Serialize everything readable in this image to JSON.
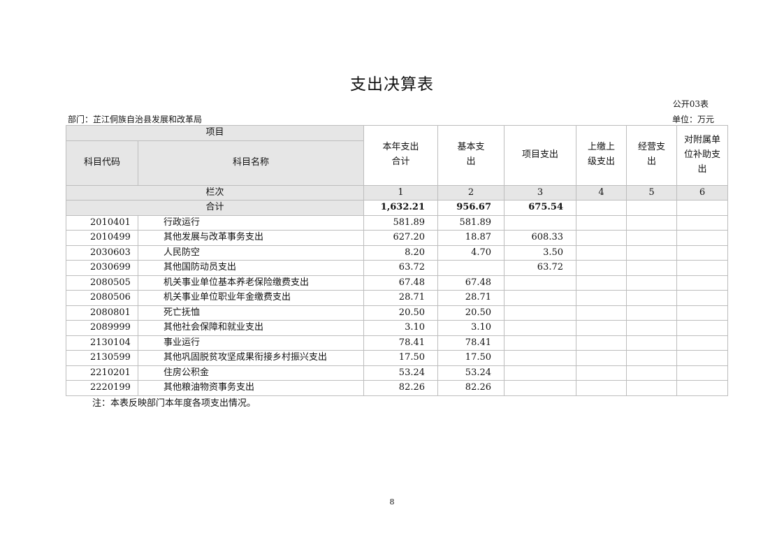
{
  "title": "支出决算表",
  "table_no": "公开03表",
  "department": "部门：芷江侗族自治县发展和改革局",
  "unit": "单位：万元",
  "header": {
    "item": "项目",
    "code": "科目代码",
    "name": "科目名称",
    "total": "本年支出合计",
    "basic": "基本支出",
    "project": "项目支出",
    "upper": "上缴上级支出",
    "business": "经营支出",
    "subsidy": "对附属单位补助支出",
    "col_label": "栏次",
    "col_nums": [
      "1",
      "2",
      "3",
      "4",
      "5",
      "6"
    ]
  },
  "sum_row": {
    "label": "合计",
    "total": "1,632.21",
    "basic": "956.67",
    "project": "675.54"
  },
  "rows": [
    {
      "code": "2010401",
      "name": "行政运行",
      "total": "581.89",
      "basic": "581.89",
      "project": ""
    },
    {
      "code": "2010499",
      "name": "其他发展与改革事务支出",
      "total": "627.20",
      "basic": "18.87",
      "project": "608.33"
    },
    {
      "code": "2030603",
      "name": "人民防空",
      "total": "8.20",
      "basic": "4.70",
      "project": "3.50"
    },
    {
      "code": "2030699",
      "name": "其他国防动员支出",
      "total": "63.72",
      "basic": "",
      "project": "63.72"
    },
    {
      "code": "2080505",
      "name": "机关事业单位基本养老保险缴费支出",
      "total": "67.48",
      "basic": "67.48",
      "project": ""
    },
    {
      "code": "2080506",
      "name": "机关事业单位职业年金缴费支出",
      "total": "28.71",
      "basic": "28.71",
      "project": ""
    },
    {
      "code": "2080801",
      "name": "死亡抚恤",
      "total": "20.50",
      "basic": "20.50",
      "project": ""
    },
    {
      "code": "2089999",
      "name": "其他社会保障和就业支出",
      "total": "3.10",
      "basic": "3.10",
      "project": ""
    },
    {
      "code": "2130104",
      "name": "事业运行",
      "total": "78.41",
      "basic": "78.41",
      "project": ""
    },
    {
      "code": "2130599",
      "name": "其他巩固脱贫攻坚成果衔接乡村振兴支出",
      "total": "17.50",
      "basic": "17.50",
      "project": ""
    },
    {
      "code": "2210201",
      "name": "住房公积金",
      "total": "53.24",
      "basic": "53.24",
      "project": ""
    },
    {
      "code": "2220199",
      "name": "其他粮油物资事务支出",
      "total": "82.26",
      "basic": "82.26",
      "project": ""
    }
  ],
  "note": "注：本表反映部门本年度各项支出情况。",
  "page_number": "8"
}
